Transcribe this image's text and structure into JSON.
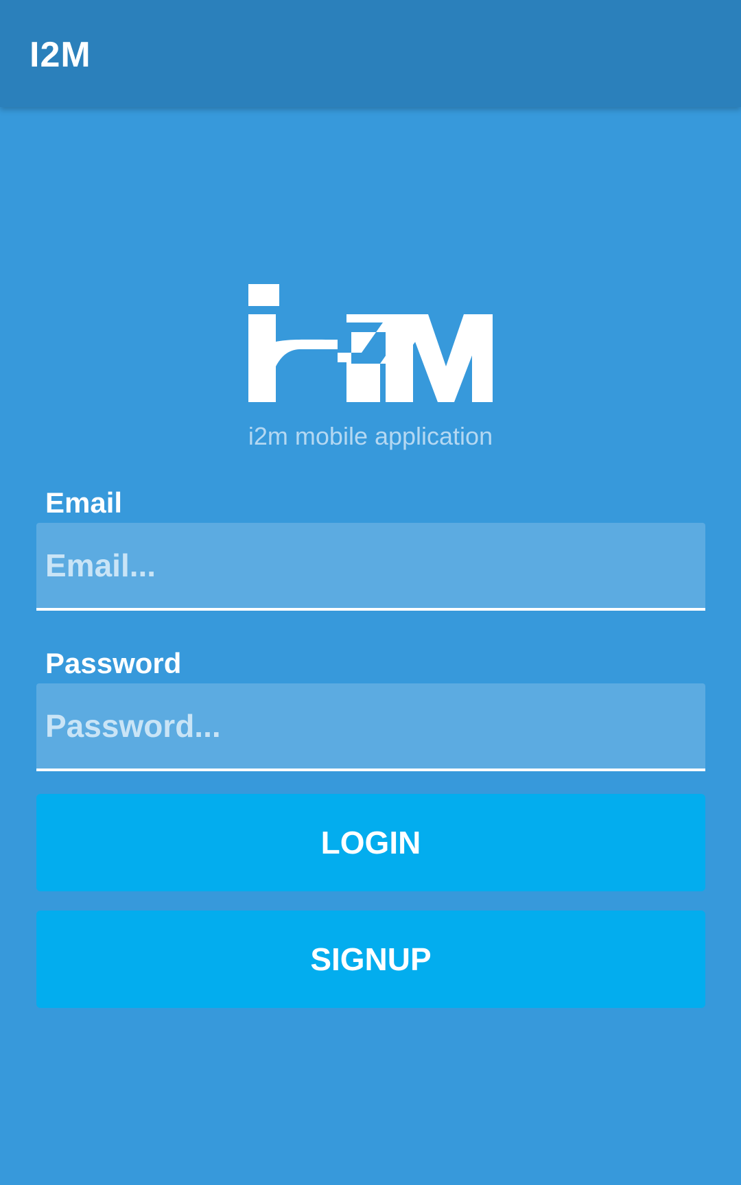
{
  "app_bar": {
    "title": "I2M"
  },
  "logo": {
    "icon": "i2m-logo",
    "text": "i2M",
    "tagline": "i2m mobile application"
  },
  "form": {
    "email": {
      "label": "Email",
      "placeholder": "Email...",
      "value": ""
    },
    "password": {
      "label": "Password",
      "placeholder": "Password...",
      "value": ""
    }
  },
  "buttons": {
    "login_label": "LOGIN",
    "signup_label": "SIGNUP"
  },
  "colors": {
    "background": "#3799db",
    "app_bar": "#2b80bb",
    "button": "#03adee",
    "input_fill": "#5cabe1",
    "text": "#ffffff"
  }
}
